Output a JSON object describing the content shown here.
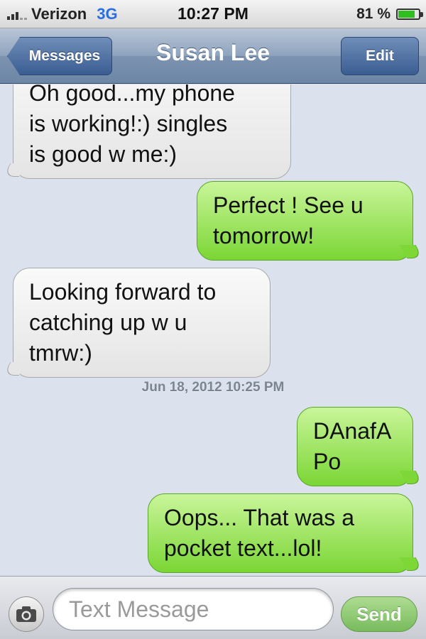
{
  "status_bar": {
    "carrier": "Verizon",
    "network": "3G",
    "time": "10:27 PM",
    "battery_percent_label": "81 %",
    "battery_level": 0.81,
    "signal_bars": 3,
    "colors": {
      "network": "#2a6ee0",
      "battery": "#2fbf1f"
    }
  },
  "nav_bar": {
    "back_label": "Messages",
    "title": "Susan Lee",
    "edit_label": "Edit"
  },
  "messages": [
    {
      "direction": "incoming",
      "text": "Oh good...my phone\nis working!:)  singles\nis good w me:)"
    },
    {
      "direction": "outgoing",
      "text": "Perfect !  See u\ntomorrow!"
    },
    {
      "direction": "incoming",
      "text": "Looking forward to\ncatching up w u\ntmrw:)"
    },
    {
      "direction": "outgoing",
      "text": "DAnafA\nPo"
    },
    {
      "direction": "outgoing",
      "text": "Oops...  That was a\npocket text...lol!"
    }
  ],
  "timestamp": "Jun 18, 2012 10:25 PM",
  "input_bar": {
    "placeholder": "Text Message",
    "value": "",
    "send_label": "Send",
    "camera_icon": "camera-icon"
  },
  "colors": {
    "background": "#dbe2ed",
    "incoming_bubble": "#e6e6e6",
    "outgoing_bubble": "#7bd635",
    "nav_bar": "#7c93b0"
  }
}
